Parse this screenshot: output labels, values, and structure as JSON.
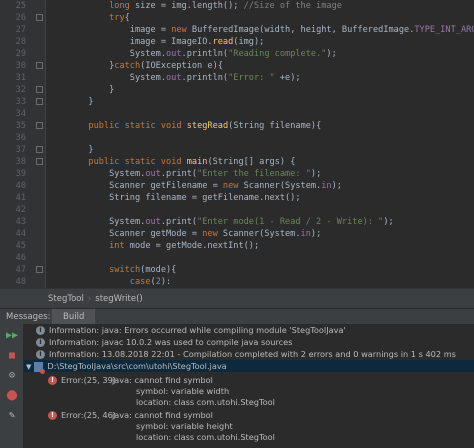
{
  "editor": {
    "line_numbers": [
      "25",
      "26",
      "27",
      "28",
      "29",
      "30",
      "31",
      "32",
      "33",
      "34",
      "35",
      "36",
      "37",
      "38",
      "39",
      "40",
      "41",
      "42",
      "43",
      "44",
      "45",
      "46",
      "47",
      "48"
    ],
    "lines": [
      [
        {
          "t": "            "
        },
        {
          "t": "long",
          "c": "kw"
        },
        {
          "t": " size = img.length(); "
        },
        {
          "t": "//Size of the image",
          "c": "cmt"
        }
      ],
      [
        {
          "t": "            "
        },
        {
          "t": "try",
          "c": "kw"
        },
        {
          "t": "{"
        }
      ],
      [
        {
          "t": "                image = "
        },
        {
          "t": "new",
          "c": "kw"
        },
        {
          "t": " BufferedImage(width, height, BufferedImage."
        },
        {
          "t": "TYPE_INT_ARGB",
          "c": "fld"
        },
        {
          "t": ");"
        }
      ],
      [
        {
          "t": "                image = ImageIO."
        },
        {
          "t": "read",
          "c": "method"
        },
        {
          "t": "(img);"
        }
      ],
      [
        {
          "t": "                System."
        },
        {
          "t": "out",
          "c": "fld"
        },
        {
          "t": ".println("
        },
        {
          "t": "\"Reading complete.\"",
          "c": "str"
        },
        {
          "t": ");"
        }
      ],
      [
        {
          "t": "            }"
        },
        {
          "t": "catch",
          "c": "kw"
        },
        {
          "t": "(IOException e){"
        }
      ],
      [
        {
          "t": "                System."
        },
        {
          "t": "out",
          "c": "fld"
        },
        {
          "t": ".println("
        },
        {
          "t": "\"Error: \"",
          "c": "str"
        },
        {
          "t": " +e);"
        }
      ],
      [
        {
          "t": "            }"
        }
      ],
      [
        {
          "t": "        }"
        }
      ],
      [
        {
          "t": ""
        }
      ],
      [
        {
          "t": "        "
        },
        {
          "t": "public static void",
          "c": "kw"
        },
        {
          "t": " "
        },
        {
          "t": "stegRead",
          "c": "method"
        },
        {
          "t": "(String filename){"
        }
      ],
      [
        {
          "t": ""
        }
      ],
      [
        {
          "t": "        }"
        }
      ],
      [
        {
          "t": "        "
        },
        {
          "t": "public static void",
          "c": "kw"
        },
        {
          "t": " "
        },
        {
          "t": "main",
          "c": "method"
        },
        {
          "t": "(String[] args) {"
        }
      ],
      [
        {
          "t": "            System."
        },
        {
          "t": "out",
          "c": "fld"
        },
        {
          "t": ".print("
        },
        {
          "t": "\"Enter the filename: \"",
          "c": "str"
        },
        {
          "t": ");"
        }
      ],
      [
        {
          "t": "            Scanner getFilename = "
        },
        {
          "t": "new",
          "c": "kw"
        },
        {
          "t": " Scanner(System."
        },
        {
          "t": "in",
          "c": "fld"
        },
        {
          "t": ");"
        }
      ],
      [
        {
          "t": "            "
        },
        {
          "t": "String",
          "c": "plain"
        },
        {
          "t": " filename = getFilename.next();"
        }
      ],
      [
        {
          "t": ""
        }
      ],
      [
        {
          "t": "            System."
        },
        {
          "t": "out",
          "c": "fld"
        },
        {
          "t": ".print("
        },
        {
          "t": "\"Enter mode(1 - Read / 2 - Write): \"",
          "c": "str"
        },
        {
          "t": ");"
        }
      ],
      [
        {
          "t": "            Scanner getMode = "
        },
        {
          "t": "new",
          "c": "kw"
        },
        {
          "t": " Scanner(System."
        },
        {
          "t": "in",
          "c": "fld"
        },
        {
          "t": ");"
        }
      ],
      [
        {
          "t": "            "
        },
        {
          "t": "int",
          "c": "kw"
        },
        {
          "t": " mode = getMode.nextInt();"
        }
      ],
      [
        {
          "t": ""
        }
      ],
      [
        {
          "t": "            "
        },
        {
          "t": "switch",
          "c": "kw"
        },
        {
          "t": "(mode){"
        }
      ],
      [
        {
          "t": "                "
        },
        {
          "t": "case",
          "c": "kw"
        },
        {
          "t": "("
        },
        {
          "t": "2",
          "c": "num"
        },
        {
          "t": "):"
        }
      ]
    ]
  },
  "breadcrumb": {
    "class_name": "StegTool",
    "method_name": "stegWrite()"
  },
  "messages": {
    "panel_title": "Messages:",
    "tab_label": "Build",
    "info_1": "Information: java: Errors occurred while compiling module 'StegToolJava'",
    "info_2": "Information: javac 10.0.2 was used to compile java sources",
    "info_3": "Information: 13.08.2018 22:01 - Compilation completed with 2 errors and 0 warnings in 1 s 402 ms",
    "file_path": "D:\\StegToolJava\\src\\com\\utohi\\StegTool.java",
    "error_1": {
      "location": "Error:(25, 39)",
      "message": "java: cannot find symbol",
      "symbol": "symbol:   variable width",
      "where": "location: class com.utohi.StegTool"
    },
    "error_2": {
      "location": "Error:(25, 46)",
      "message": "java: cannot find symbol",
      "symbol": "symbol:   variable height",
      "where": "location: class com.utohi.StegTool"
    }
  }
}
